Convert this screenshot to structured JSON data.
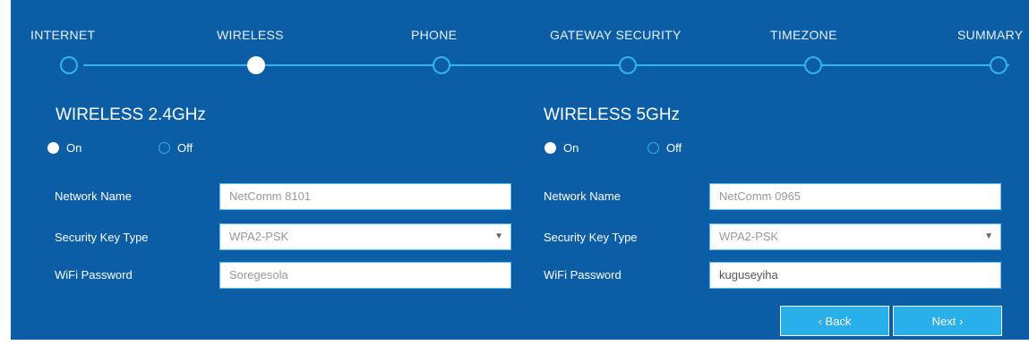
{
  "steps": [
    {
      "label": "INTERNET",
      "active": false
    },
    {
      "label": "WIRELESS",
      "active": true
    },
    {
      "label": "PHONE",
      "active": false
    },
    {
      "label": "GATEWAY SECURITY",
      "active": false
    },
    {
      "label": "TIMEZONE",
      "active": false
    },
    {
      "label": "SUMMARY",
      "active": false
    }
  ],
  "band24": {
    "title": "WIRELESS 2.4GHz",
    "on_label": "On",
    "off_label": "Off",
    "state": "On",
    "network_name_label": "Network Name",
    "network_name_placeholder": "NetComm 8101",
    "security_key_type_label": "Security Key Type",
    "security_key_type_value": "WPA2-PSK",
    "wifi_password_label": "WiFi Password",
    "wifi_password_value": "Soregesola"
  },
  "band5": {
    "title": "WIRELESS 5GHz",
    "on_label": "On",
    "off_label": "Off",
    "state": "On",
    "network_name_label": "Network Name",
    "network_name_placeholder": "NetComm 0965",
    "security_key_type_label": "Security Key Type",
    "security_key_type_value": "WPA2-PSK",
    "wifi_password_label": "WiFi Password",
    "wifi_password_value": "kuguseyiha"
  },
  "nav": {
    "back_label": "‹ Back",
    "next_label": "Next ›"
  },
  "colors": {
    "panel_bg": "#0b5ea6",
    "accent": "#32b4e8",
    "button_bg": "#29b0ea"
  }
}
